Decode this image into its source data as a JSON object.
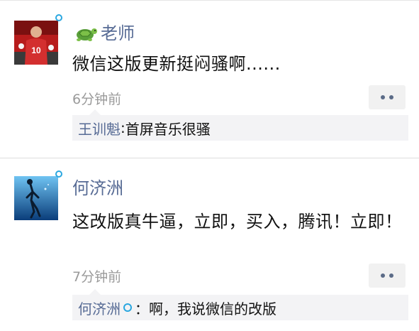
{
  "posts": [
    {
      "name": "老师",
      "content": "微信这版更新挺闷骚啊......",
      "time": "6分钟前",
      "comment": {
        "author": "王训魁",
        "separator": ": ",
        "text": "首屏音乐很骚"
      }
    },
    {
      "name": "何济洲",
      "content": "这改版真牛逼，立即，买入，腾讯！立即！",
      "time": "7分钟前",
      "comment": {
        "author": "何济洲",
        "separator": "：",
        "text": "啊，我说微信的改版"
      }
    }
  ],
  "colors": {
    "name_link": "#576b95",
    "timestamp": "#9a9a9a",
    "status_ring": "#2aa7e0"
  },
  "icons": [
    "turtle-icon",
    "more-dots-icon",
    "status-ring-icon"
  ]
}
